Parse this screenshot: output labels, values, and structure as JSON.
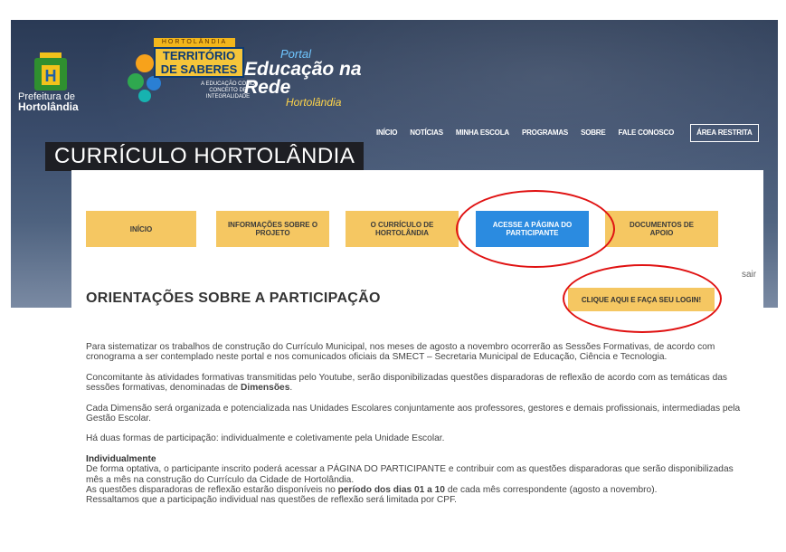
{
  "brand": {
    "prefeitura_line1": "Prefeitura de",
    "prefeitura_line2": "Hortolândia",
    "territorio_band": "HORTOLÂNDIA",
    "territorio_title": "TERRITÓRIO DE SABERES",
    "territorio_sub": "A EDUCAÇÃO COMO CONCEITO DE INTEGRALIDADE",
    "portal_line1": "Portal",
    "portal_line2": "Educação na Rede",
    "portal_line3": "Hortolândia"
  },
  "nav": {
    "items": [
      "INÍCIO",
      "NOTÍCIAS",
      "MINHA ESCOLA",
      "PROGRAMAS",
      "SOBRE",
      "FALE CONOSCO"
    ],
    "restricted": "ÁREA RESTRITA"
  },
  "page_title": "CURRÍCULO HORTOLÂNDIA",
  "tabs": [
    {
      "label": "INÍCIO"
    },
    {
      "label": "INFORMAÇÕES SOBRE O PROJETO"
    },
    {
      "label": "O CURRÍCULO DE HORTOLÂNDIA"
    },
    {
      "label": "ACESSE A PÁGINA DO PARTICIPANTE"
    },
    {
      "label": "DOCUMENTOS DE APOIO"
    }
  ],
  "sair": "sair",
  "section_title": "ORIENTAÇÕES SOBRE A PARTICIPAÇÃO",
  "login_button": "CLIQUE AQUI E FAÇA SEU LOGIN!",
  "paragraphs": {
    "p1": "Para sistematizar os trabalhos de construção do Currículo Municipal, nos meses de agosto a novembro ocorrerão as Sessões Formativas, de acordo com cronograma a ser contemplado neste portal e nos comunicados oficiais da SMECT – Secretaria Municipal de Educação, Ciência e Tecnologia.",
    "p2_a": "Concomitante às atividades formativas transmitidas pelo Youtube, serão disponibilizadas questões disparadoras de reflexão de acordo com as temáticas das sessões formativas, denominadas de ",
    "p2_b": "Dimensões",
    "p2_c": ".",
    "p3": "Cada Dimensão será organizada e potencializada nas Unidades Escolares conjuntamente aos professores, gestores e demais profissionais, intermediadas pela Gestão Escolar.",
    "p4": "Há duas formas de participação: individualmente e coletivamente pela Unidade Escolar.",
    "individual_heading": "Individualmente",
    "ind_1": "De forma optativa, o participante inscrito poderá acessar a PÁGINA DO PARTICIPANTE e contribuir com as questões disparadoras que serão disponibilizadas mês a mês na construção do Currículo da Cidade de Hortolândia.",
    "ind_2_a": "As questões disparadoras de reflexão estarão disponíveis no ",
    "ind_2_b": "período dos dias 01 a 10",
    "ind_2_c": " de cada mês correspondente (agosto a novembro).",
    "ind_3": "Ressaltamos que a participação individual nas questões de reflexão será limitada por CPF."
  },
  "colors": {
    "tab_yellow": "#f5c762",
    "tab_active": "#2b8be0",
    "highlight_ellipse": "#e01212"
  }
}
